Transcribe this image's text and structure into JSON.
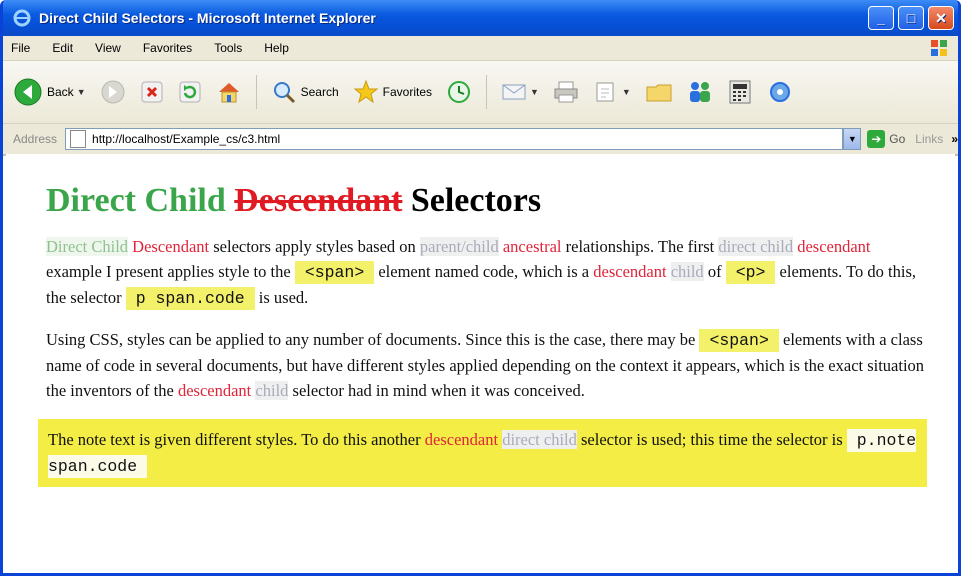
{
  "window": {
    "title": "Direct Child Selectors - Microsoft Internet Explorer"
  },
  "menu": [
    "File",
    "Edit",
    "View",
    "Favorites",
    "Tools",
    "Help"
  ],
  "toolbar": {
    "back_label": "Back",
    "search_label": "Search",
    "favorites_label": "Favorites"
  },
  "address": {
    "label": "Address",
    "url": "http://localhost/Example_cs/c3.html",
    "go_label": "Go",
    "links_label": "Links"
  },
  "page": {
    "heading": {
      "part1": "Direct Child",
      "part2": "Descendant",
      "part3": "Selectors"
    },
    "p1": {
      "t1": "Direct Child",
      "t2": "Descendant",
      "t3": " selectors apply styles based on ",
      "t4": "parent/child",
      "t5": "ancestral",
      "t6": " relationships. The first ",
      "t7": "direct child",
      "t8": "descendant",
      "t9": " example I present applies style to the ",
      "t10": "<span>",
      "t11": " element named code, which is a ",
      "t12": "descendant",
      "t13": "child",
      "t14": " of ",
      "t15": "<p>",
      "t16": " elements. To do this, the selector ",
      "t17": "p  span.code",
      "t18": " is used."
    },
    "p2": {
      "t1": "Using CSS, styles can be applied to any number of documents. Since this is the case, there may be ",
      "t2": "<span>",
      "t3": " elements with a class name of code in several documents, but have different styles applied depending on the context it appears, which is the exact situation the inventors of the ",
      "t4": "descendant",
      "t5": "child",
      "t6": " selector had in mind when it was conceived."
    },
    "note": {
      "t1": "The note text is given different styles. To do this another ",
      "t2": "descendant",
      "t3": "direct child",
      "t4": " selector is used; this time the selector is ",
      "t5": "p.note  span.code"
    }
  },
  "colors": {
    "titlebar": "#0a5ae0",
    "chrome": "#ece9d8",
    "heading_green": "#3aa54a",
    "heading_red": "#e01a22",
    "code_highlight": "#f3f06a",
    "note_bg": "#f3ed45"
  }
}
